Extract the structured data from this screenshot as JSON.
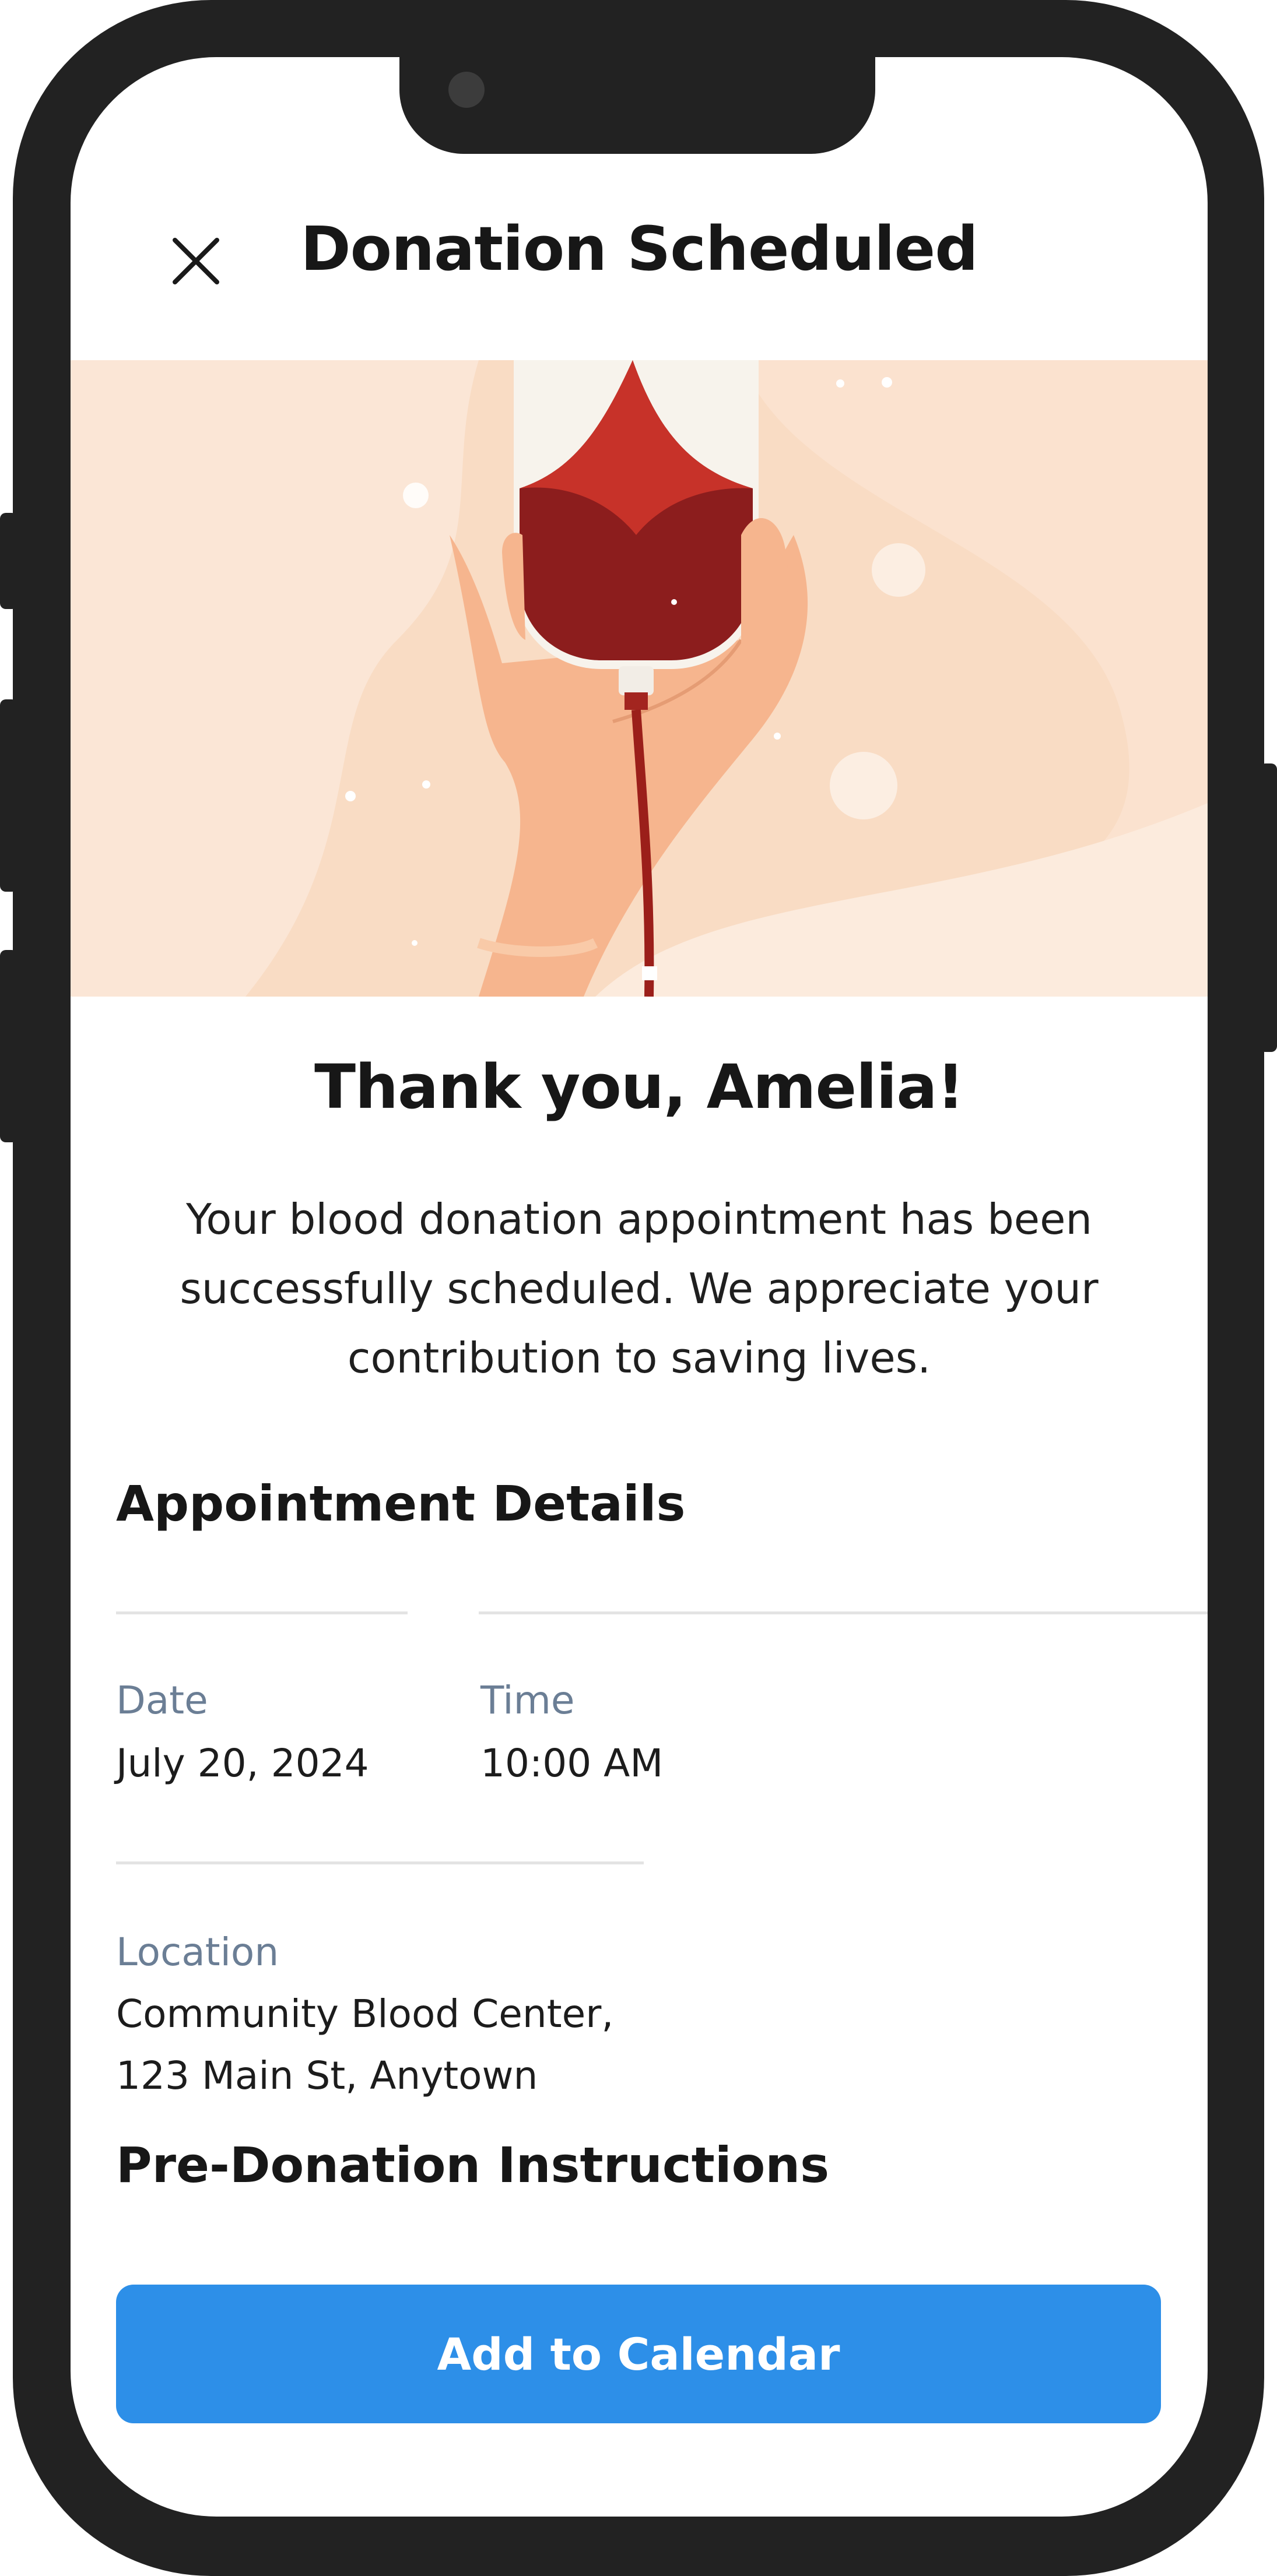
{
  "header": {
    "title": "Donation Scheduled",
    "close_icon": "close-icon"
  },
  "hero": {
    "illustration": "blood-bag-in-hand-illustration",
    "colors": {
      "background": "#f9dcc4",
      "blood": "#8c1d1d",
      "skin": "#f6b58e"
    }
  },
  "confirmation": {
    "heading": "Thank you, Amelia!",
    "message": "Your blood donation appointment has been successfully scheduled. We appreciate your contribution to saving lives."
  },
  "appointment": {
    "heading": "Appointment Details",
    "date_label": "Date",
    "date_value": "July 20, 2024",
    "time_label": "Time",
    "time_value": "10:00 AM",
    "location_label": "Location",
    "location_value": "Community Blood Center, 123 Main St, Anytown"
  },
  "instructions": {
    "heading": "Pre-Donation Instructions"
  },
  "actions": {
    "add_to_calendar_label": "Add to Calendar"
  },
  "colors": {
    "accent": "#2d8fe8",
    "label": "#6b7e95",
    "frame": "#222222"
  }
}
